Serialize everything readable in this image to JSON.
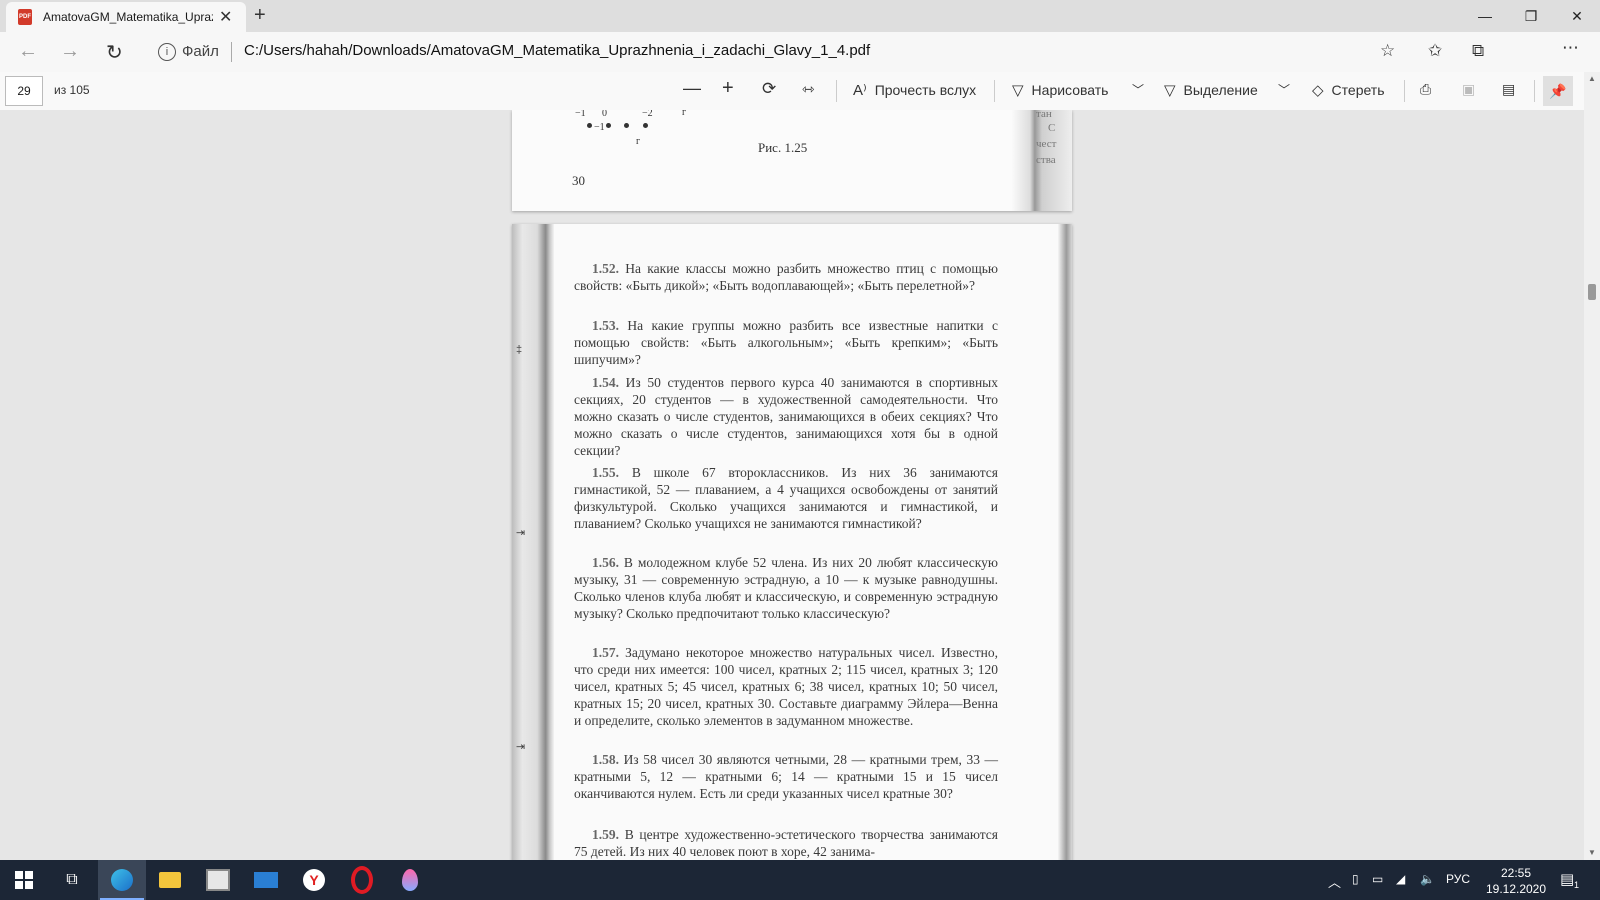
{
  "browser": {
    "tab_title": "AmatovaGM_Matematika_Uprazhnenia_i_zadachi_Glavy_1_4.pdf",
    "pdf_badge": "PDF",
    "address_prefix": "Файл",
    "address_url": "C:/Users/hahah/Downloads/AmatovaGM_Matematika_Uprazhnenia_i_zadachi_Glavy_1_4.pdf"
  },
  "pdf_toolbar": {
    "page_current": "29",
    "page_total": "из 105",
    "read_aloud": "Прочесть вслух",
    "draw": "Нарисовать",
    "highlight": "Выделение",
    "erase": "Стереть"
  },
  "page_prev": {
    "caption": "Рис. 1.25",
    "page_number": "30",
    "fragments": [
      "−1",
      "0",
      "−2",
      "−1",
      "г",
      "г"
    ],
    "side_fragments": [
      "тан",
      "С",
      "чест",
      "ства"
    ]
  },
  "problems": [
    {
      "num": "1.52.",
      "text": "На какие классы можно разбить множество птиц с помощью свойств: «Быть дикой»; «Быть водоплавающей»; «Быть перелетной»?"
    },
    {
      "num": "1.53.",
      "text": "На какие группы можно разбить все известные напитки с помощью свойств: «Быть алкогольным»; «Быть крепким»; «Быть шипучим»?"
    },
    {
      "num": "1.54.",
      "text": "Из 50 студентов первого курса 40 занимаются в спортивных секциях, 20 студентов — в художественной самодеятельности. Что можно сказать о числе студентов, занимающихся в обеих секциях? Что можно сказать о числе студентов, занимающихся хотя бы в одной секции?"
    },
    {
      "num": "1.55.",
      "text": "В школе 67 второклассников. Из них 36 занимаются гимнастикой, 52 — плаванием, а 4 учащихся освобождены от занятий физкультурой. Сколько учащихся занимаются и гимнастикой, и плаванием? Сколько учащихся не занимаются гимнастикой?"
    },
    {
      "num": "1.56.",
      "text": "В молодежном клубе 52 члена. Из них 20 любят классическую музыку, 31 — современную эстрадную, а 10 — к музыке равнодушны. Сколько членов клуба любят и классическую, и современную эстрадную музыку? Сколько предпочитают только классическую?"
    },
    {
      "num": "1.57.",
      "text": "Задумано некоторое множество натуральных чисел. Известно, что среди них имеется: 100 чисел, кратных 2; 115 чисел, кратных 3; 120 чисел, кратных 5; 45 чисел, кратных 6; 38 чисел, кратных 10; 50 чисел, кратных 15; 20 чисел, кратных 30. Составьте диаграмму Эйлера—Венна и определите, сколько элементов в задуманном множестве."
    },
    {
      "num": "1.58.",
      "text": "Из 58 чисел 30 являются четными, 28 — кратными трем, 33 — кратными 5, 12 — кратными 6; 14 — кратными 15 и 15 чисел оканчиваются нулем. Есть ли среди указанных чисел кратные 30?"
    },
    {
      "num": "1.59.",
      "text": "В центре художественно-эстетического творчества занимаются 75 детей. Из них 40 человек поют в хоре, 42 занима-"
    }
  ],
  "margin_marks": [
    "‡",
    "⇥",
    "⇥"
  ],
  "taskbar": {
    "language": "РУС",
    "time": "22:55",
    "date": "19.12.2020",
    "notifications": "1"
  }
}
